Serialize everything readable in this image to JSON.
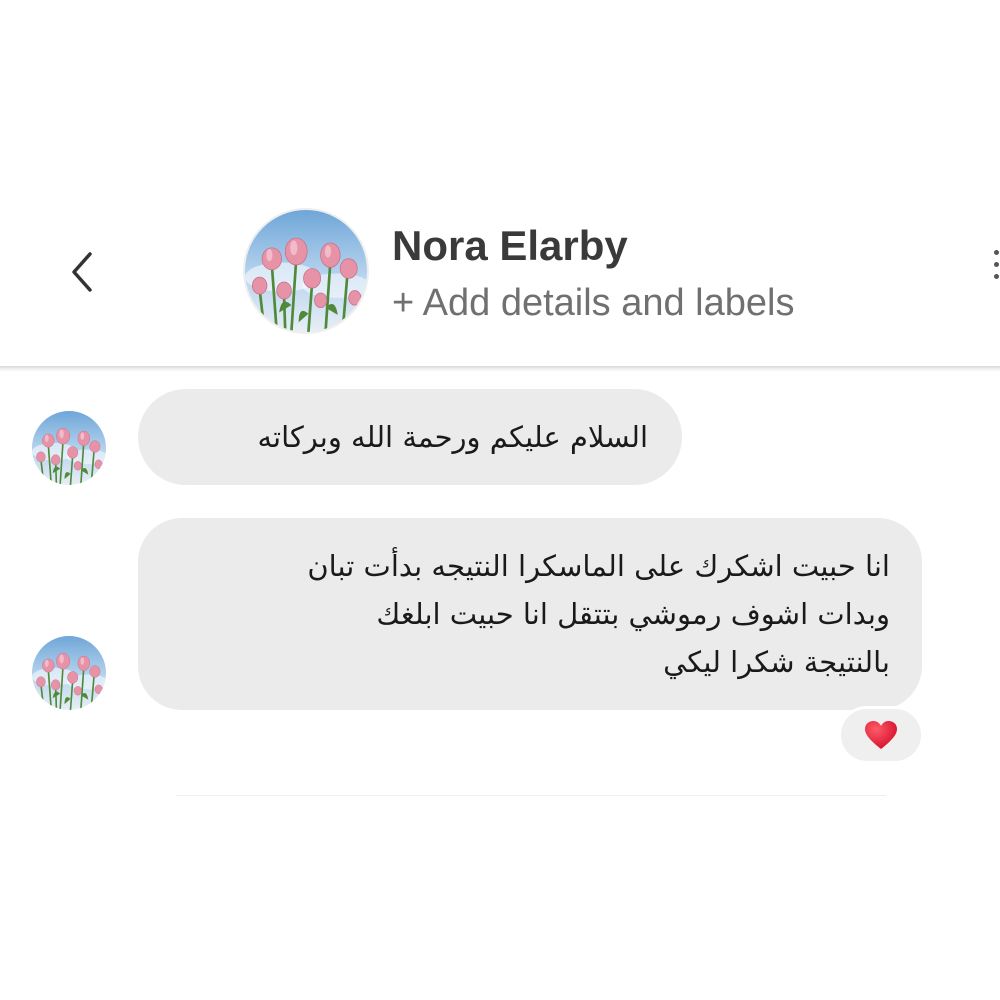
{
  "header": {
    "contact_name": "Nora Elarby",
    "add_details_label": "+ Add details and labels",
    "back_icon": "chevron-left-icon",
    "menu_icon": "more-vertical-icon"
  },
  "messages": [
    {
      "sender": "contact",
      "lines": [
        "السلام عليكم ورحمة الله وبركاته"
      ]
    },
    {
      "sender": "contact",
      "lines": [
        "انا حبيت اشكرك على الماسكرا النتيجه بدأت تبان",
        "وبدات اشوف رموشي بتتقل انا حبيت ابلغك",
        "بالنتيجة شكرا ليكي"
      ],
      "reaction": "heart-icon"
    }
  ],
  "colors": {
    "bubble": "#ebebeb",
    "heart": "#e0112b",
    "name": "#3a3a3a",
    "subtitle": "#707070"
  }
}
